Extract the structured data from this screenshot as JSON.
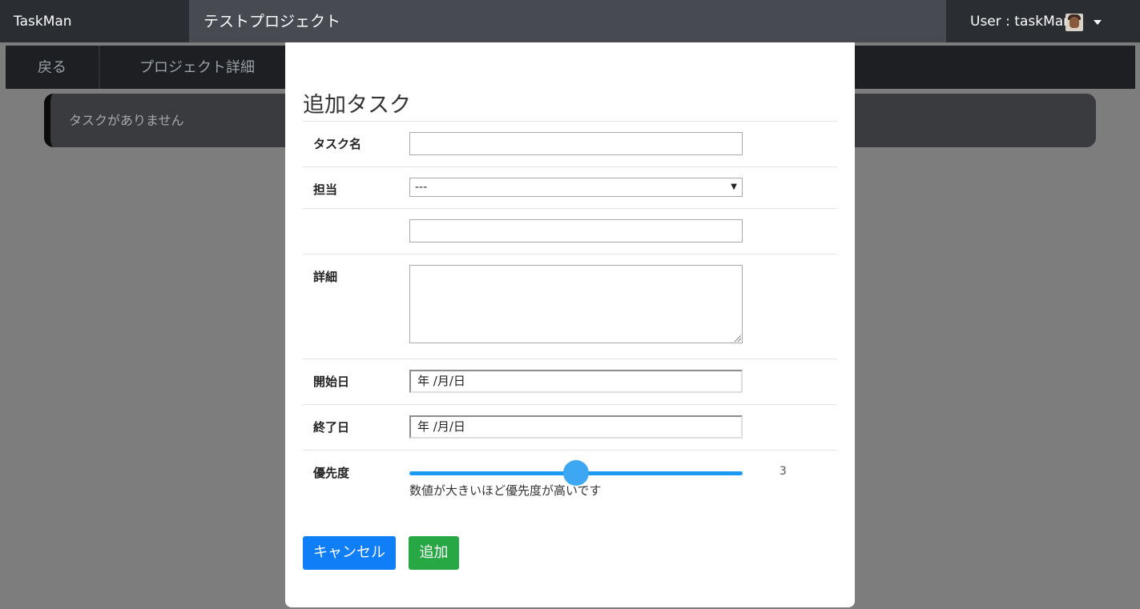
{
  "header": {
    "brand": "TaskMan",
    "project_title": "テストプロジェクト",
    "user_label": "User : taskMan"
  },
  "subnav": {
    "back": "戻る",
    "project_detail": "プロジェクト詳細"
  },
  "tasks": {
    "empty_message": "タスクがありません"
  },
  "modal": {
    "title": "追加タスク",
    "fields": {
      "task_name": {
        "label": "タスク名",
        "value": ""
      },
      "assignee": {
        "label": "担当",
        "selected": "---"
      },
      "extra": {
        "value": ""
      },
      "detail": {
        "label": "詳細",
        "value": ""
      },
      "start_date": {
        "label": "開始日",
        "value": "年 /月/日"
      },
      "end_date": {
        "label": "終了日",
        "value": "年 /月/日"
      },
      "priority": {
        "label": "優先度",
        "value": "3",
        "hint": "数値が大きいほど優先度が高いです"
      }
    },
    "buttons": {
      "cancel": "キャンセル",
      "add": "追加"
    }
  },
  "colors": {
    "primary": "#0f7ef7",
    "success": "#28a745",
    "slider": "#1a9af3"
  }
}
